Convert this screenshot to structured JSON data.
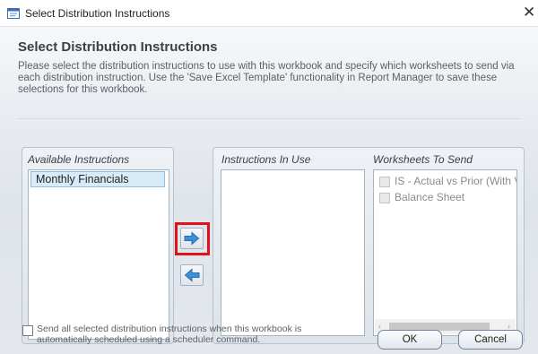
{
  "window": {
    "title": "Select Distribution Instructions",
    "close_glyph": "✕",
    "icon": "app-window-icon"
  },
  "dialog": {
    "heading": "Select Distribution Instructions",
    "description": "Please select the distribution instructions to use with this workbook and specify which worksheets to send via each distribution instruction. Use the 'Save Excel Template' functionality in Report Manager to save these selections for this workbook."
  },
  "available": {
    "label": "Available Instructions",
    "items": [
      "Monthly Financials"
    ],
    "selected_index": 0
  },
  "in_use": {
    "label": "Instructions In Use",
    "items": []
  },
  "worksheets": {
    "label": "Worksheets To Send",
    "items": [
      {
        "label": "IS - Actual vs Prior (With V",
        "checked": false,
        "enabled": false
      },
      {
        "label": "Balance Sheet",
        "checked": false,
        "enabled": false
      }
    ],
    "scroll_left_glyph": "‹",
    "scroll_right_glyph": "›"
  },
  "transfer": {
    "add_icon": "arrow-right-icon",
    "remove_icon": "arrow-left-icon",
    "highlight_color": "#e0111b"
  },
  "footer": {
    "schedule_checkbox_label": "Send all selected distribution instructions when this workbook is automatically scheduled using a scheduler command.",
    "schedule_checked": false,
    "ok_label": "OK",
    "cancel_label": "Cancel"
  },
  "colors": {
    "arrow_blue": "#3d8fd6",
    "selection_bg": "#d8ebf8",
    "selection_border": "#8cc1e6"
  }
}
